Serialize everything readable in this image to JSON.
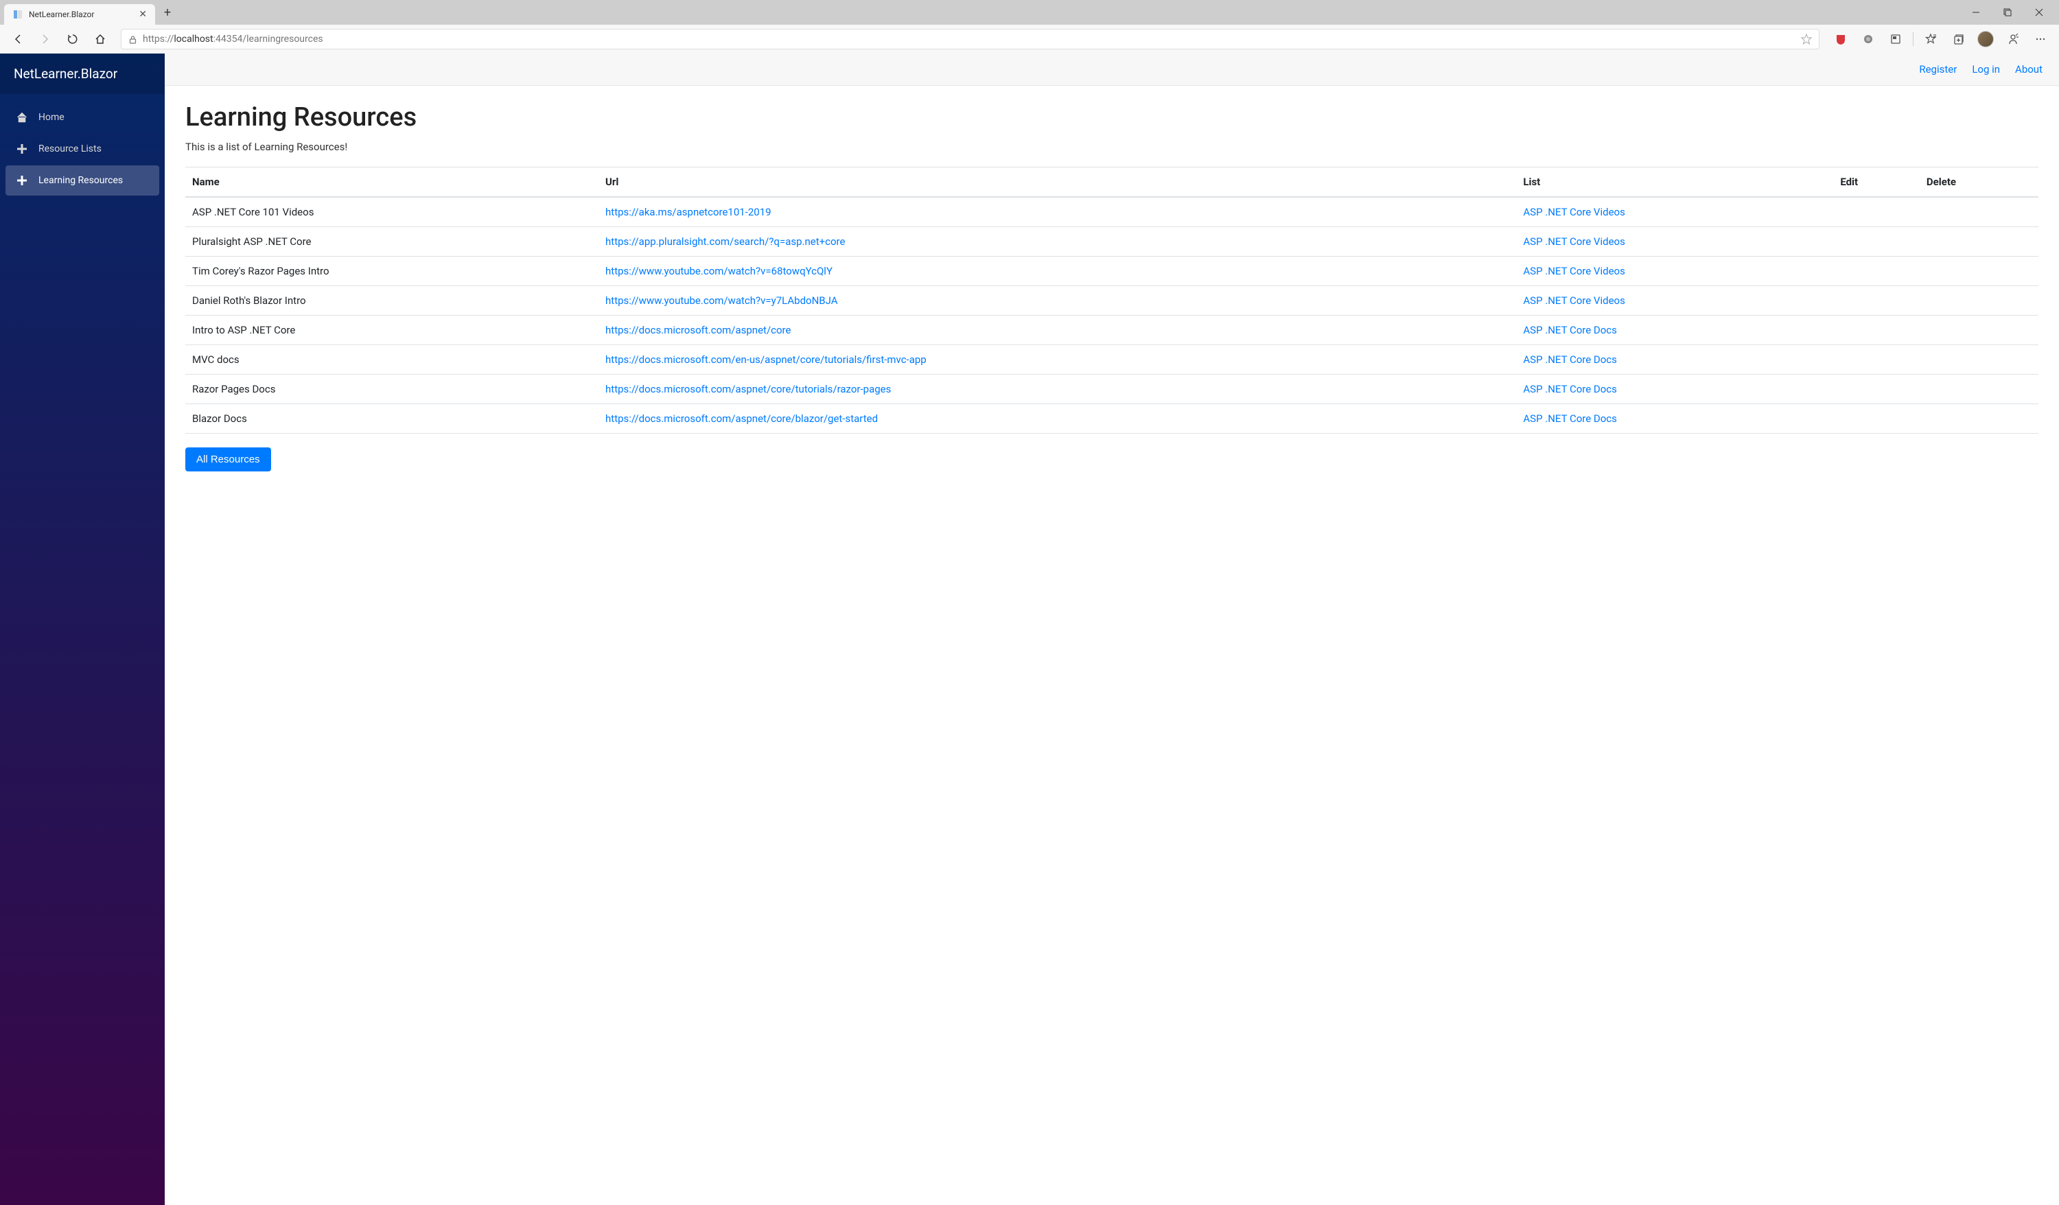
{
  "browser": {
    "tab_title": "NetLearner.Blazor",
    "url_prefix": "https://",
    "url_host": "localhost",
    "url_port": ":44354",
    "url_path": "/learningresources"
  },
  "sidebar": {
    "brand": "NetLearner.Blazor",
    "items": [
      {
        "label": "Home",
        "active": false
      },
      {
        "label": "Resource Lists",
        "active": false
      },
      {
        "label": "Learning Resources",
        "active": true
      }
    ]
  },
  "topbar": {
    "register": "Register",
    "login": "Log in",
    "about": "About"
  },
  "page": {
    "title": "Learning Resources",
    "subtitle": "This is a list of Learning Resources!",
    "headers": {
      "name": "Name",
      "url": "Url",
      "list": "List",
      "edit": "Edit",
      "delete": "Delete"
    },
    "rows": [
      {
        "name": "ASP .NET Core 101 Videos",
        "url": "https://aka.ms/aspnetcore101-2019",
        "list": "ASP .NET Core Videos"
      },
      {
        "name": "Pluralsight ASP .NET Core",
        "url": "https://app.pluralsight.com/search/?q=asp.net+core",
        "list": "ASP .NET Core Videos"
      },
      {
        "name": "Tim Corey's Razor Pages Intro",
        "url": "https://www.youtube.com/watch?v=68towqYcQlY",
        "list": "ASP .NET Core Videos"
      },
      {
        "name": "Daniel Roth's Blazor Intro",
        "url": "https://www.youtube.com/watch?v=y7LAbdoNBJA",
        "list": "ASP .NET Core Videos"
      },
      {
        "name": "Intro to ASP .NET Core",
        "url": "https://docs.microsoft.com/aspnet/core",
        "list": "ASP .NET Core Docs"
      },
      {
        "name": "MVC docs",
        "url": "https://docs.microsoft.com/en-us/aspnet/core/tutorials/first-mvc-app",
        "list": "ASP .NET Core Docs"
      },
      {
        "name": "Razor Pages Docs",
        "url": "https://docs.microsoft.com/aspnet/core/tutorials/razor-pages",
        "list": "ASP .NET Core Docs"
      },
      {
        "name": "Blazor Docs",
        "url": "https://docs.microsoft.com/aspnet/core/blazor/get-started",
        "list": "ASP .NET Core Docs"
      }
    ],
    "all_resources_btn": "All Resources"
  }
}
